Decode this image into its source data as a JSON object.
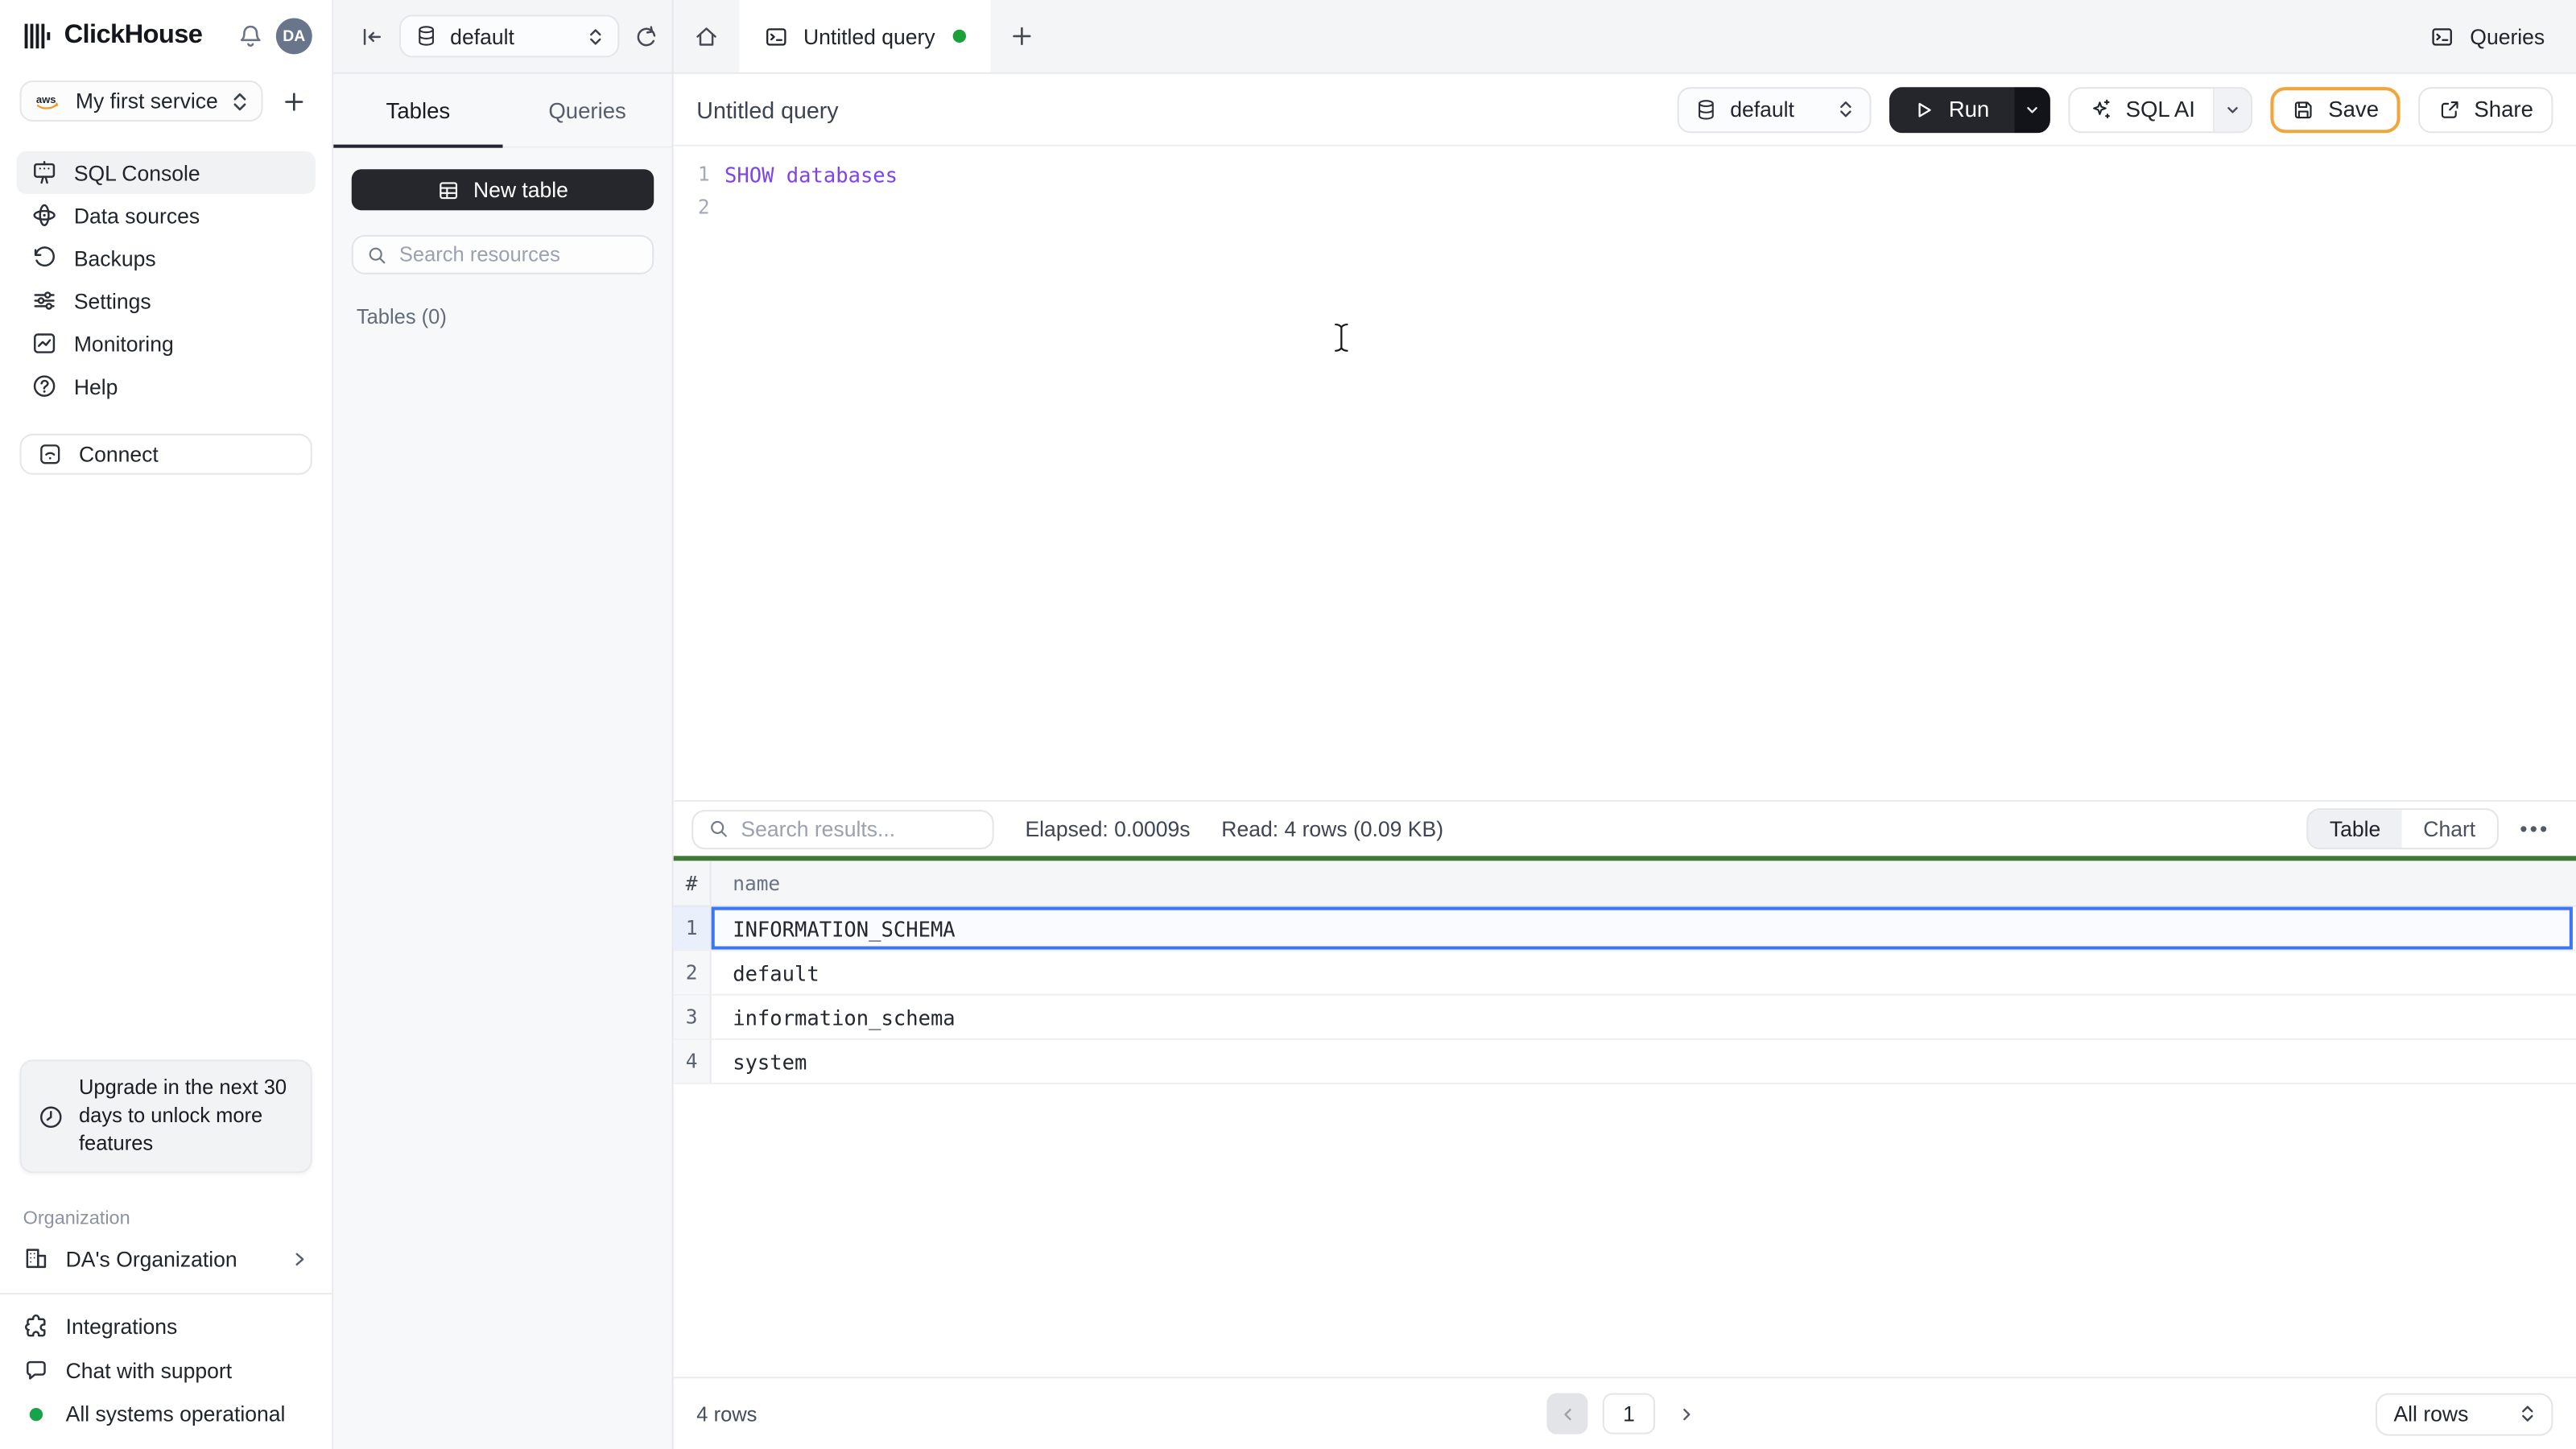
{
  "header": {
    "brand": "ClickHouse",
    "avatar_initials": "DA"
  },
  "sidebar": {
    "service": {
      "name": "My first service"
    },
    "nav": [
      {
        "label": "SQL Console",
        "active": true
      },
      {
        "label": "Data sources",
        "active": false
      },
      {
        "label": "Backups",
        "active": false
      },
      {
        "label": "Settings",
        "active": false
      },
      {
        "label": "Monitoring",
        "active": false
      },
      {
        "label": "Help",
        "active": false
      }
    ],
    "connect": "Connect",
    "upgrade": "Upgrade in the next 30 days to unlock more features",
    "org_section": "Organization",
    "org_name": "DA's Organization",
    "links": [
      {
        "label": "Integrations"
      },
      {
        "label": "Chat with support"
      }
    ],
    "status": "All systems operational"
  },
  "topstrip": {
    "database": "default",
    "tab": "Untitled query",
    "queries": "Queries"
  },
  "resources": {
    "tab_tables": "Tables",
    "tab_queries": "Queries",
    "new_table": "New table",
    "search_placeholder": "Search resources",
    "tables_count": "Tables (0)"
  },
  "editor_header": {
    "title": "Untitled query",
    "database": "default",
    "run": "Run",
    "sql_ai": "SQL AI",
    "save": "Save",
    "share": "Share"
  },
  "editor": {
    "lines": [
      {
        "no": "1",
        "code": "SHOW databases"
      },
      {
        "no": "2",
        "code": ""
      }
    ]
  },
  "results": {
    "search_placeholder": "Search results...",
    "elapsed": "Elapsed: 0.0009s",
    "read": "Read: 4 rows (0.09 KB)",
    "toggle": {
      "table": "Table",
      "chart": "Chart",
      "active": "Table"
    },
    "columns": {
      "index": "#",
      "name": "name"
    },
    "rows": [
      {
        "n": "1",
        "name": "INFORMATION_SCHEMA",
        "selected": true
      },
      {
        "n": "2",
        "name": "default",
        "selected": false
      },
      {
        "n": "3",
        "name": "information_schema",
        "selected": false
      },
      {
        "n": "4",
        "name": "system",
        "selected": false
      }
    ],
    "row_count": "4 rows",
    "page": "1",
    "page_size": "All rows"
  },
  "icons": {
    "clickhouse-logo": "bars",
    "bell-icon": "bell",
    "avatar": "initials-circle",
    "aws-icon": "aws-smile",
    "chevron-updown-icon": "updown",
    "plus-icon": "plus",
    "sql-console-icon": "presentation",
    "data-sources-icon": "orbit",
    "backups-icon": "history",
    "settings-icon": "sliders",
    "monitoring-icon": "chart-square",
    "help-icon": "question-circle",
    "connect-icon": "wifi-square",
    "clock-icon": "clock",
    "building-icon": "building",
    "chevron-right-icon": "chevron",
    "puzzle-icon": "puzzle",
    "chat-icon": "speech-bubble",
    "collapse-left-icon": "arrow-to-bar",
    "database-icon": "cylinder",
    "refresh-icon": "circular-arrow",
    "home-icon": "house",
    "terminal-icon": "terminal-window",
    "play-icon": "triangle",
    "chevron-down-icon": "caret",
    "sparkles-icon": "sparkles",
    "save-icon": "floppy",
    "share-icon": "external-arrow",
    "search-icon": "magnifier",
    "more-icon": "ellipsis",
    "text-cursor": "i-beam"
  },
  "colors": {
    "save_border": "#F0A63E",
    "run_button": "#25262B",
    "selection_blue": "#3B76F6",
    "result_success_green": "#3C7A2F",
    "status_green": "#16A34A",
    "code_purple": "#7B44EC",
    "topstrip_bg": "#F4F5F6",
    "panel_bg": "#F7F8F9"
  }
}
